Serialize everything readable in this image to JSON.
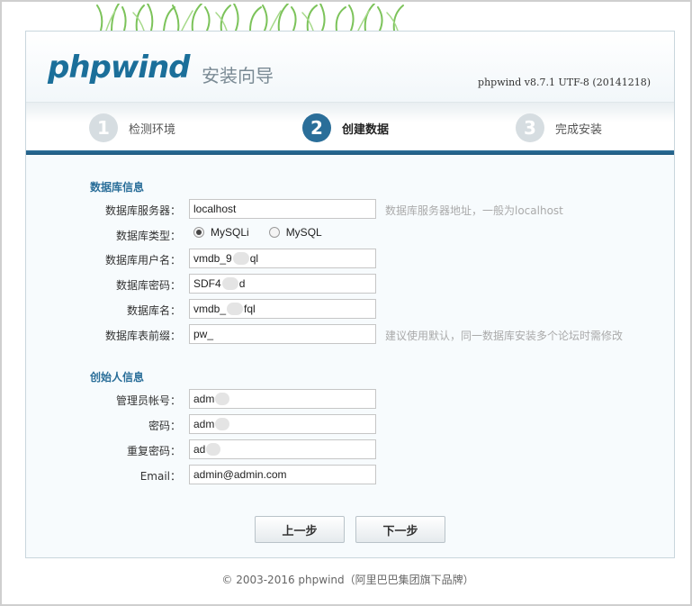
{
  "header": {
    "logo": "phpwind",
    "wizard_title": "安装向导",
    "version": "phpwind v8.7.1 UTF-8 (20141218)"
  },
  "steps": [
    {
      "number": "1",
      "label": "检测环境",
      "state": "done"
    },
    {
      "number": "2",
      "label": "创建数据",
      "state": "active"
    },
    {
      "number": "3",
      "label": "完成安装",
      "state": "pending"
    }
  ],
  "db": {
    "section_title": "数据库信息",
    "server_label": "数据库服务器：",
    "server_value": "localhost",
    "server_hint": "数据库服务器地址，一般为localhost",
    "type_label": "数据库类型：",
    "type_options": [
      "MySQLi",
      "MySQL"
    ],
    "type_selected": "MySQLi",
    "user_label": "数据库用户名：",
    "user_value": "vmdb_9",
    "user_value_tail": "ql",
    "password_label": "数据库密码：",
    "password_value": "SDF4",
    "password_value_tail": "d",
    "name_label": "数据库名：",
    "name_value": "vmdb_",
    "name_value_tail": "fql",
    "prefix_label": "数据库表前缀：",
    "prefix_value": "pw_",
    "prefix_hint": "建议使用默认，同一数据库安装多个论坛时需修改"
  },
  "founder": {
    "section_title": "创始人信息",
    "account_label": "管理员帐号：",
    "account_value": "adm",
    "password_label": "密码：",
    "password_value": "adm",
    "repeat_label": "重复密码：",
    "repeat_value": "ad",
    "email_label": "Email：",
    "email_value": "admin@admin.com"
  },
  "buttons": {
    "prev": "上一步",
    "next": "下一步"
  },
  "footer": "© 2003-2016 phpwind（阿里巴巴集团旗下品牌）",
  "colors": {
    "accent": "#2a6e99",
    "hint": "#aaaaaa",
    "step_inactive": "#d6dde1"
  }
}
